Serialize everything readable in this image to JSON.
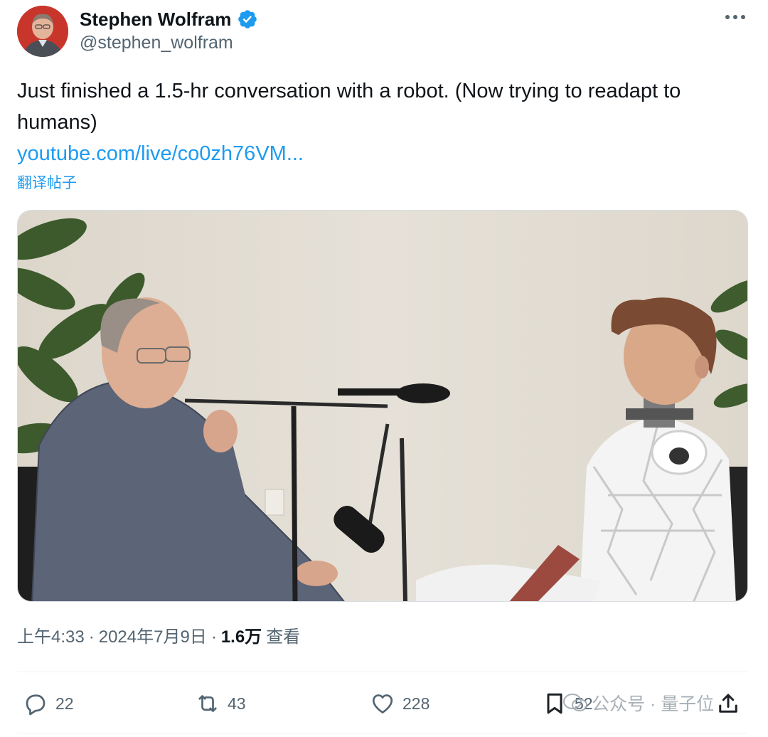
{
  "author": {
    "name": "Stephen Wolfram",
    "handle": "@stephen_wolfram",
    "verified": true,
    "avatar": "avatar-photo"
  },
  "post": {
    "text": "Just finished a 1.5-hr conversation with a robot. (Now trying to readapt to humans)",
    "link_text": "youtube.com/live/co0zh76VM...",
    "translate_label": "翻译帖子",
    "media": "video-still-man-talking-with-humanoid-robot"
  },
  "meta": {
    "time": "上午4:33",
    "sep1": "·",
    "date": "2024年7月9日",
    "sep2": "·",
    "views_count": "1.6万",
    "views_label": "查看"
  },
  "actions": {
    "replies": "22",
    "reposts": "43",
    "likes": "228",
    "bookmarks": "52"
  },
  "watermark": "公众号 · 量子位",
  "colors": {
    "accent": "#1d9bf0",
    "secondary_text": "#536471",
    "primary_text": "#0f1419"
  }
}
